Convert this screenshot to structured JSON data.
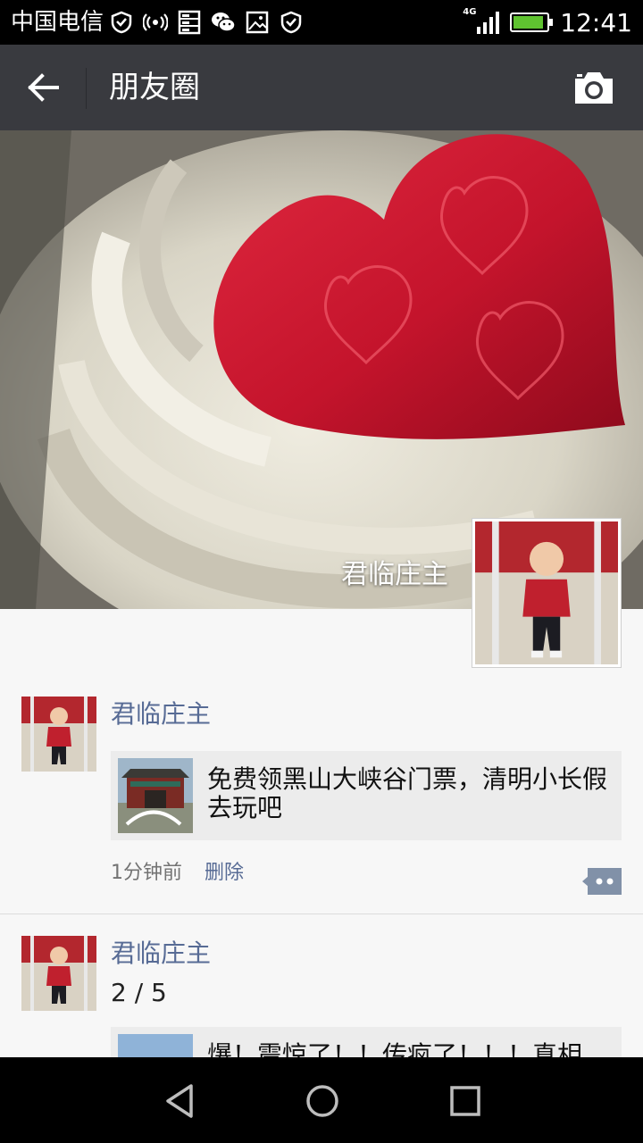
{
  "status_bar": {
    "carrier": "中国电信",
    "network": "4G",
    "time": "12:41",
    "battery_level": 0.9,
    "icons": [
      "shield-icon",
      "radio-signal-icon",
      "storage-icon",
      "wechat-icon",
      "image-icon",
      "shield-icon"
    ]
  },
  "header": {
    "title": "朋友圈",
    "back_icon": "arrow-left-icon",
    "camera_icon": "camera-icon"
  },
  "cover": {
    "owner_name": "君临庄主"
  },
  "posts": [
    {
      "author": "君临庄主",
      "share_title": "免费领黑山大峡谷门票，清明小长假去玩吧",
      "time": "1分钟前",
      "delete_label": "删除"
    },
    {
      "author": "君临庄主",
      "text": "2 / 5",
      "share_title": "爆！震惊了！！传疯了！！！真相"
    }
  ],
  "colors": {
    "title_bar": "#393a3f",
    "link_blue": "#576b95",
    "background": "#f7f7f7"
  }
}
